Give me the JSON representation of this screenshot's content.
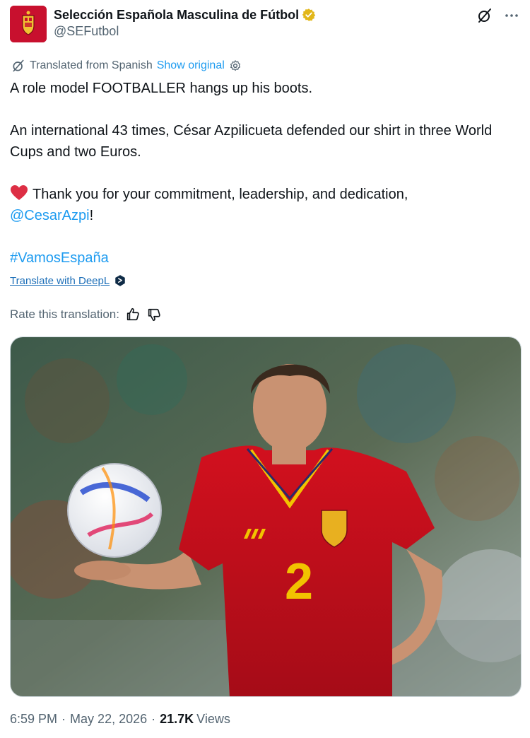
{
  "account": {
    "display_name": "Selección Española Masculina de Fútbol",
    "handle": "@SEFutbol",
    "verified_color": "#e2b719"
  },
  "translation_bar": {
    "label": "Translated from Spanish",
    "show_original": "Show original"
  },
  "tweet": {
    "line1": "A role model FOOTBALLER hangs up his boots.",
    "line2": "An international 43 times, César Azpilicueta defended our shirt in three World Cups and two Euros.",
    "line3_text": "Thank you for your commitment, leadership, and dedication,",
    "mention": "@CesarAzpi",
    "mention_suffix": "!",
    "hashtag": "#VamosEspaña"
  },
  "deepl": {
    "label": "Translate with DeepL"
  },
  "rate": {
    "label": "Rate this translation:"
  },
  "media": {
    "jersey_number": "2"
  },
  "footer": {
    "time": "6:59 PM",
    "date": "May 22, 2026",
    "views_count": "21.7K",
    "views_label": "Views"
  },
  "colors": {
    "link": "#1d9bf0",
    "muted": "#536471",
    "text": "#0f1419",
    "jersey_red": "#c8102e"
  },
  "icons": [
    "grok-icon",
    "more-icon",
    "translate-icon",
    "settings-icon",
    "heart-icon",
    "deepl-icon",
    "thumbs-up-icon",
    "thumbs-down-icon",
    "verified-icon"
  ]
}
